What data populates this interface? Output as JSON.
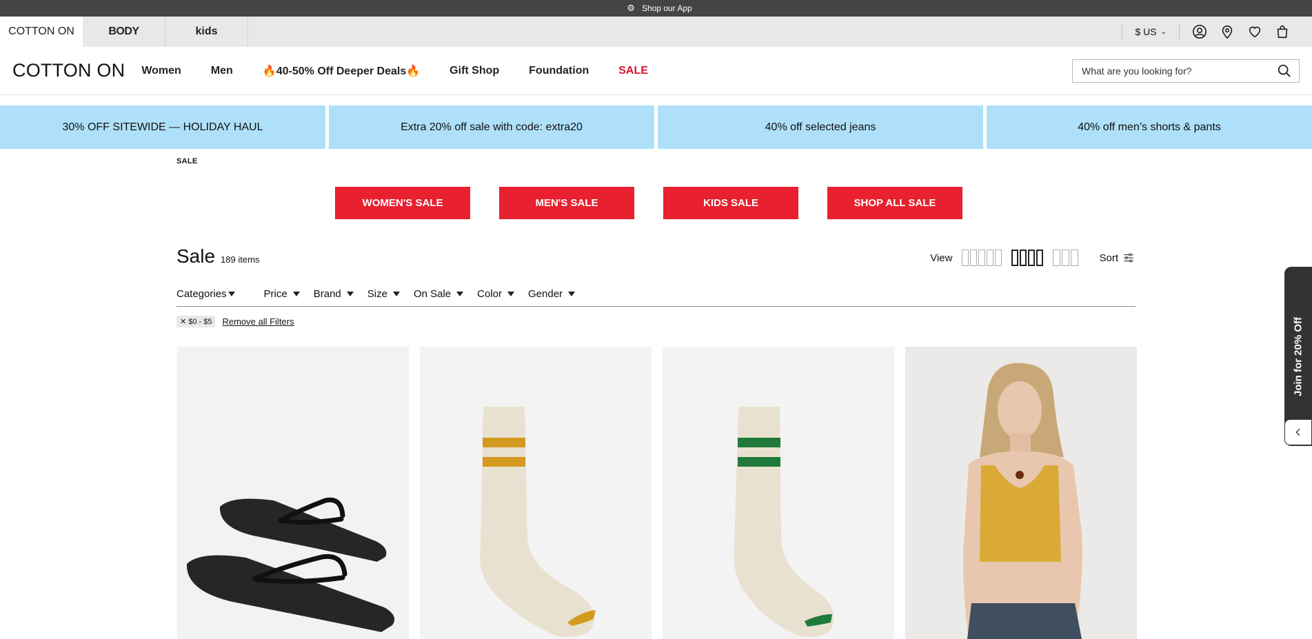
{
  "appbar": {
    "text": "Shop our App",
    "icons": [
      "apple-icon",
      "android-icon"
    ]
  },
  "brand_tabs": [
    {
      "label": "COTTON ON"
    },
    {
      "label": "BODY"
    },
    {
      "label": "kids"
    }
  ],
  "utility": {
    "currency": "$ US",
    "icons": [
      "account-icon",
      "store-locator-icon",
      "wishlist-icon",
      "bag-icon"
    ]
  },
  "nav": {
    "logo": "COTTON ON",
    "items": [
      "Women",
      "Men",
      "🔥40-50% Off Deeper Deals🔥",
      "Gift Shop",
      "Foundation",
      "SALE"
    ],
    "search_placeholder": "What are you looking for?"
  },
  "promos": [
    "30% OFF SITEWIDE — HOLIDAY HAUL",
    "Extra 20% off sale with code: extra20",
    "40% off selected jeans",
    "40% off men’s shorts & pants"
  ],
  "breadcrumb": "SALE",
  "sale_buttons": [
    "WOMEN'S SALE",
    "MEN'S SALE",
    "KIDS SALE",
    "SHOP ALL SALE"
  ],
  "listing": {
    "title": "Sale",
    "count": "189 items",
    "view_label": "View",
    "sort_label": "Sort"
  },
  "filters": [
    "Categories",
    "Price",
    "Brand",
    "Size",
    "On Sale",
    "Color",
    "Gender"
  ],
  "active_filters": {
    "chip": "$0 - $5",
    "remove_all": "Remove all Filters"
  },
  "side_promo": "Join for 20% Off",
  "colors": {
    "sale_red": "#e8202f",
    "promo_blue": "#aee0f9"
  }
}
